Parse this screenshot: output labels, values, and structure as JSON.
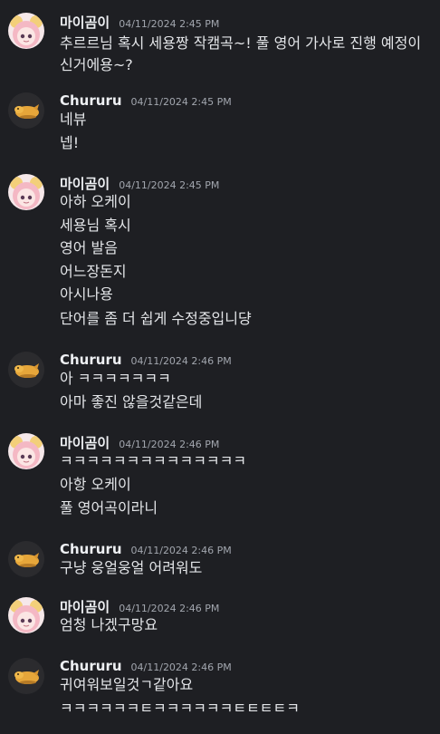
{
  "users": {
    "mai": {
      "name": "마이곰이",
      "avatar_icon": "anime-girl-avatar-icon"
    },
    "chururu": {
      "name": "Chururu",
      "avatar_icon": "yellow-creature-avatar-icon"
    }
  },
  "messages": [
    {
      "user": "마이곰이",
      "time": "04/11/2024 2:45 PM",
      "lines": [
        "추르르님 혹시 세용짱 작캠곡~! 풀 영어 가사로 진행 예정이신거에용~?"
      ]
    },
    {
      "user": "Chururu",
      "time": "04/11/2024 2:45 PM",
      "lines": [
        "네뷰",
        "넵!"
      ]
    },
    {
      "user": "마이곰이",
      "time": "04/11/2024 2:45 PM",
      "lines": [
        "아하 오케이",
        "세용님 혹시",
        "영어 발음",
        "어느장돈지",
        "아시나용",
        "단어를 좀 더 쉽게 수정중입니댱"
      ]
    },
    {
      "user": "Chururu",
      "time": "04/11/2024 2:46 PM",
      "lines": [
        "아 ㅋㅋㅋㅋㅋㅋㅋ",
        "아마 좋진 않을것같은데"
      ]
    },
    {
      "user": "마이곰이",
      "time": "04/11/2024 2:46 PM",
      "lines": [
        "ㅋㅋㅋㅋㅋㅋㅋㅋㅋㅋㅋㅋㅋㅋ",
        "아항 오케이",
        "풀 영어곡이라니"
      ]
    },
    {
      "user": "Chururu",
      "time": "04/11/2024 2:46 PM",
      "lines": [
        "구냥 웅얼웅얼 어려워도"
      ]
    },
    {
      "user": "마이곰이",
      "time": "04/11/2024 2:46 PM",
      "lines": [
        "엄청 나겠구망요"
      ]
    },
    {
      "user": "Chururu",
      "time": "04/11/2024 2:46 PM",
      "lines": [
        "귀여워보일것ㄱ같아요",
        "ㅋㅋㅋㅋㅋㅋㅌㅋㅋㅋㅋㅋㅋㅌㅌㅌㅌㅋ"
      ]
    }
  ]
}
